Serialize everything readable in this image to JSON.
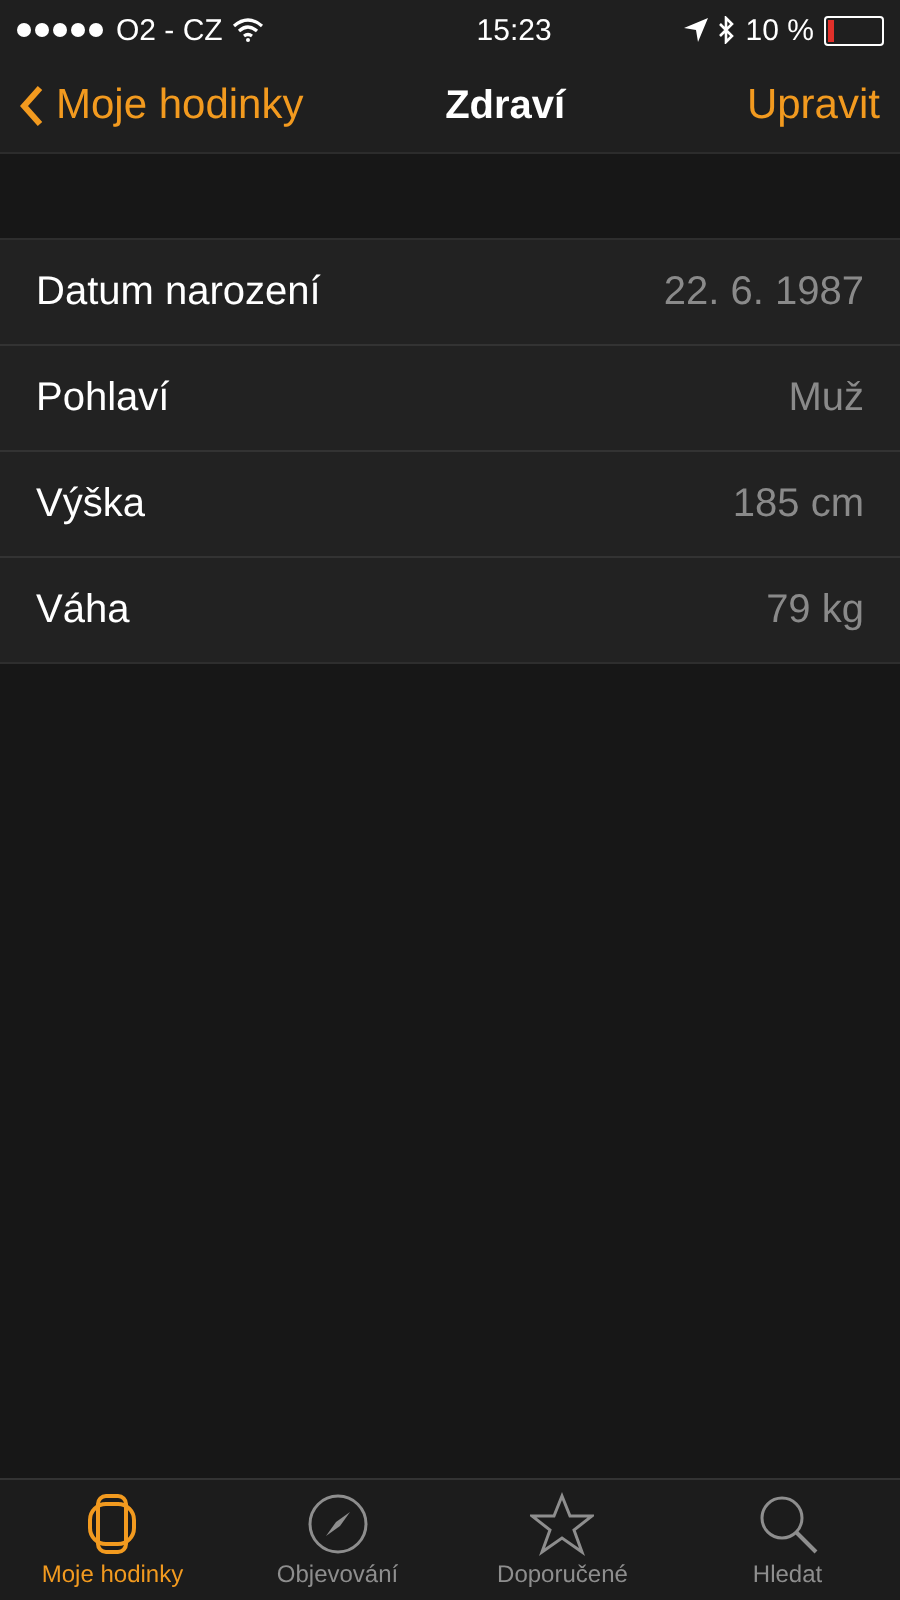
{
  "status_bar": {
    "carrier": "O2 - CZ",
    "time": "15:23",
    "battery": "10 %"
  },
  "nav": {
    "back": "Moje hodinky",
    "title": "Zdraví",
    "action": "Upravit"
  },
  "rows": [
    {
      "label": "Datum narození",
      "value": "22. 6. 1987"
    },
    {
      "label": "Pohlaví",
      "value": "Muž"
    },
    {
      "label": "Výška",
      "value": "185 cm"
    },
    {
      "label": "Váha",
      "value": "79 kg"
    }
  ],
  "tabs": [
    {
      "label": "Moje hodinky",
      "kind": "watch",
      "selected": true
    },
    {
      "label": "Objevování",
      "kind": "compass",
      "selected": false
    },
    {
      "label": "Doporučené",
      "kind": "star",
      "selected": false
    },
    {
      "label": "Hledat",
      "kind": "search",
      "selected": false
    }
  ]
}
